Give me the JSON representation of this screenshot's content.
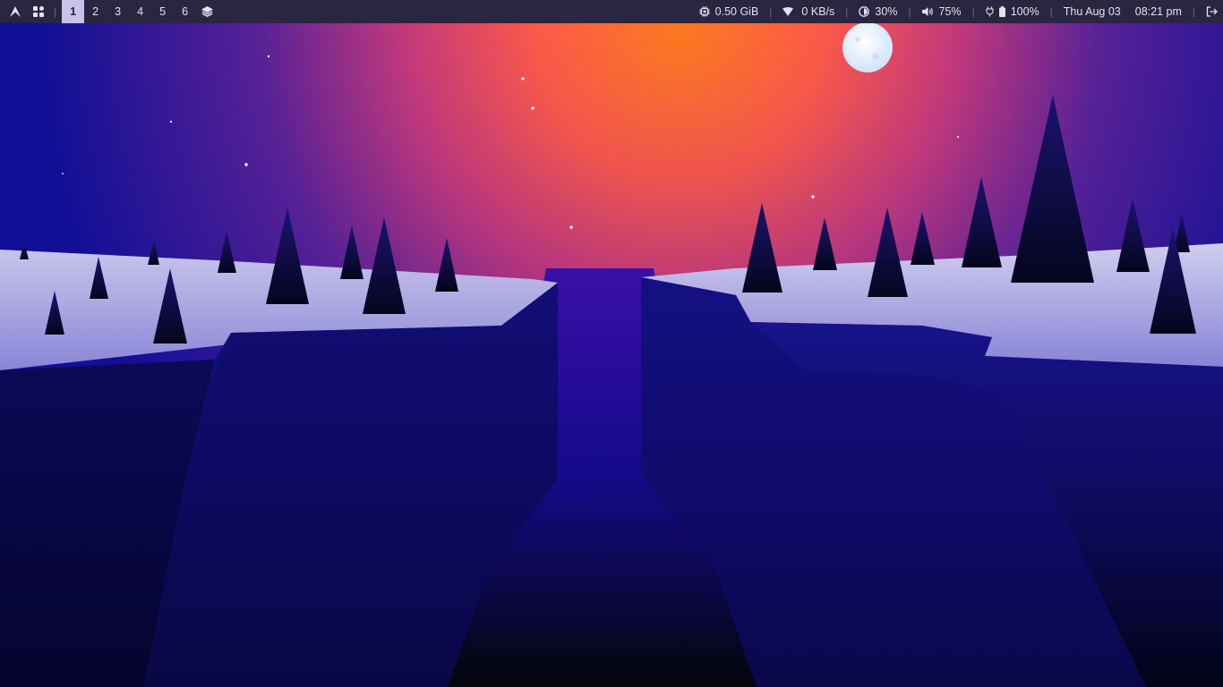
{
  "workspaces": [
    {
      "label": "1",
      "active": true
    },
    {
      "label": "2",
      "active": false
    },
    {
      "label": "3",
      "active": false
    },
    {
      "label": "4",
      "active": false
    },
    {
      "label": "5",
      "active": false
    },
    {
      "label": "6",
      "active": false
    }
  ],
  "status": {
    "memory": "0.50 GiB",
    "network": "0 KB/s",
    "brightness": "30%",
    "volume": "75%",
    "battery": "100%",
    "date": "Thu Aug 03",
    "time": "08:21 pm"
  },
  "separator": "|",
  "icons": {
    "launcher": "arch-logo-icon",
    "apps": "app-grid-icon",
    "layers": "layers-icon",
    "memory": "chip-icon",
    "network": "wifi-icon",
    "brightness": "brightness-icon",
    "volume": "speaker-icon",
    "power": "plug-icon",
    "battery": "battery-icon",
    "logout": "logout-icon"
  },
  "colors": {
    "bar_bg": "#2a2540",
    "bar_text": "#e4e2ee",
    "active_ws_bg": "#c9c2ea",
    "sky_top": "#0d0f94",
    "sky_glow": "#ff7a1f",
    "snow": "#c4c0e8",
    "cliff": "#14107a",
    "tree": "#0a0a3a"
  }
}
